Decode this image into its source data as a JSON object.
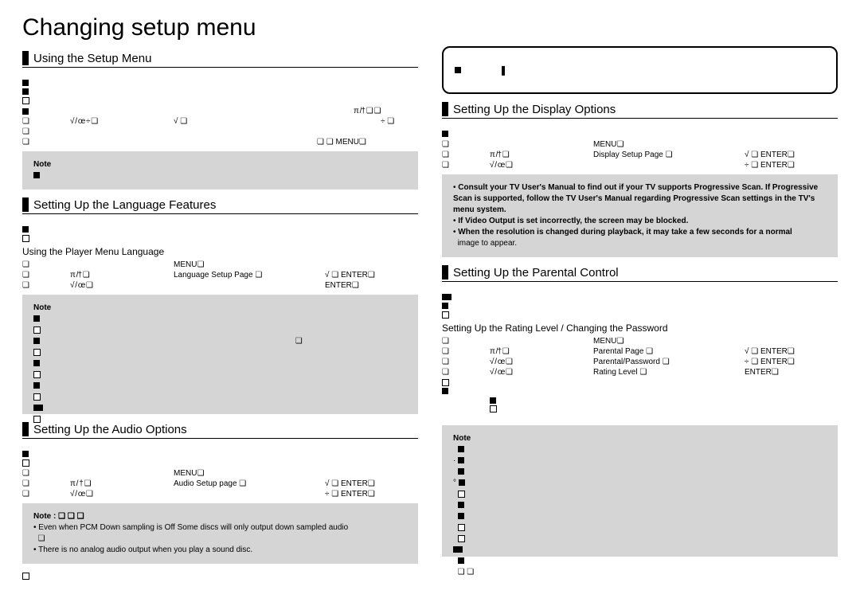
{
  "page_title": "Changing setup menu",
  "left": {
    "s1": {
      "title": "Using the Setup Menu",
      "line_arrows": "π /†  ❏  ❏",
      "line_arrows2": "†/ ÷ /œ / √   ❏",
      "line_lr": "  √ / œ    ÷  ❏",
      "line_menu": "❏   ❏                                    MENU❏",
      "note_title": "Note"
    },
    "s2": {
      "title": "Setting Up the Language Features",
      "sub": "Using the Player Menu Language",
      "step1_a": "❏",
      "step1_menu": "MENU❏",
      "step2_a": "❏",
      "step2_arrows": "π /† ❏",
      "step2_page": "Language Setup Page  ❏",
      "step2_enter": "√  ❏  ENTER❏",
      "step3_a": "❏",
      "step3_arrows": "√ / œ ❏",
      "step3_enter": "ENTER❏",
      "note_title": "Note"
    },
    "s3": {
      "title": "Setting Up the Audio Options",
      "step1_menu": "MENU❏",
      "step2_arrows": "π / † ❏",
      "step2_page": "Audio Setup page  ❏",
      "step2_enter": "√  ❏  ENTER❏",
      "step3_arrows": "√ / œ ❏",
      "step3_enter": "÷  ❏  ENTER❏",
      "note_title": "Note :   ❏    ❏         ❏",
      "note_b1": "Even when PCM Down sampling is Off Some discs will only output down sampled audio",
      "note_b1b": "❏",
      "note_b2": "There is no analog audio output when you play a sound disc."
    }
  },
  "right": {
    "topbox": {
      "icon1": "■",
      "icon2": "❚"
    },
    "s4": {
      "title": "Setting Up the Display Options",
      "step1_menu": "MENU❏",
      "step2_arrows": "π /† ❏",
      "step2_page": "Display Setup Page  ❏",
      "step2_enter": "√  ❏  ENTER❏",
      "step3_arrows": "√ / œ ❏",
      "step3_enter": "÷  ❏  ENTER❏",
      "note_b1": "Consult your TV User's Manual to find out if your TV supports Progressive Scan. If Progressive Scan is supported, follow the TV User's Manual regarding Progressive Scan settings in the TV's menu system.",
      "note_b2": "If Video Output is set incorrectly, the screen may be blocked.",
      "note_b3": "When the resolution is changed during playback, it may take a few seconds for a normal",
      "note_b3b": "image to appear."
    },
    "s5": {
      "title": "Setting Up the Parental Control",
      "sub": "Setting Up the Rating Level /     Changing the Password",
      "step1_menu": "MENU❏",
      "step2_arrows": "π /† ❏",
      "step2_page": "Parental Page ❏",
      "step2_enter": "√  ❏  ENTER❏",
      "step3_arrows": "√ / œ ❏",
      "step3_page": "Parental/Password  ❏",
      "step3_enter": "÷  ❏  ENTER❏",
      "step4_arrows": "√ / œ ❏",
      "step4_page": "Rating Level ❏",
      "step4_enter": "ENTER❏",
      "note_title": "Note",
      "foot_icons": "❏  ❏"
    }
  }
}
